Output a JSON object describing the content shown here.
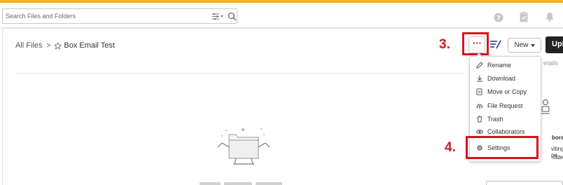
{
  "search": {
    "placeholder": "Search Files and Folders"
  },
  "header_icons": [
    "help-icon",
    "tasks-icon",
    "bell-icon"
  ],
  "breadcrumb": {
    "root": "All Files",
    "separator": ">",
    "current": "Box Email Test"
  },
  "toolbar": {
    "more_label": "···",
    "new_label": "New",
    "upload_label": "Upl"
  },
  "details_tab_peek": "etails",
  "more_menu": {
    "items": [
      {
        "label": "Rename",
        "icon": "pencil-icon"
      },
      {
        "label": "Download",
        "icon": "download-icon"
      },
      {
        "label": "Move or Copy",
        "icon": "move-copy-icon"
      },
      {
        "label": "File Request",
        "icon": "upload-cloud-icon"
      },
      {
        "label": "Trash",
        "icon": "trash-icon"
      },
      {
        "label": "Collaborators",
        "icon": "eye-icon"
      },
      {
        "label": "Settings",
        "icon": "gear-icon"
      }
    ]
  },
  "annotations": {
    "step3": "3.",
    "step4": "4."
  },
  "side_panel": {
    "title": "borators",
    "line1": "viting pe",
    "line2": "older."
  },
  "colors": {
    "accent_bar": "#f2b51c",
    "annotation_red": "#d6141f",
    "upload_button": "#222222"
  }
}
